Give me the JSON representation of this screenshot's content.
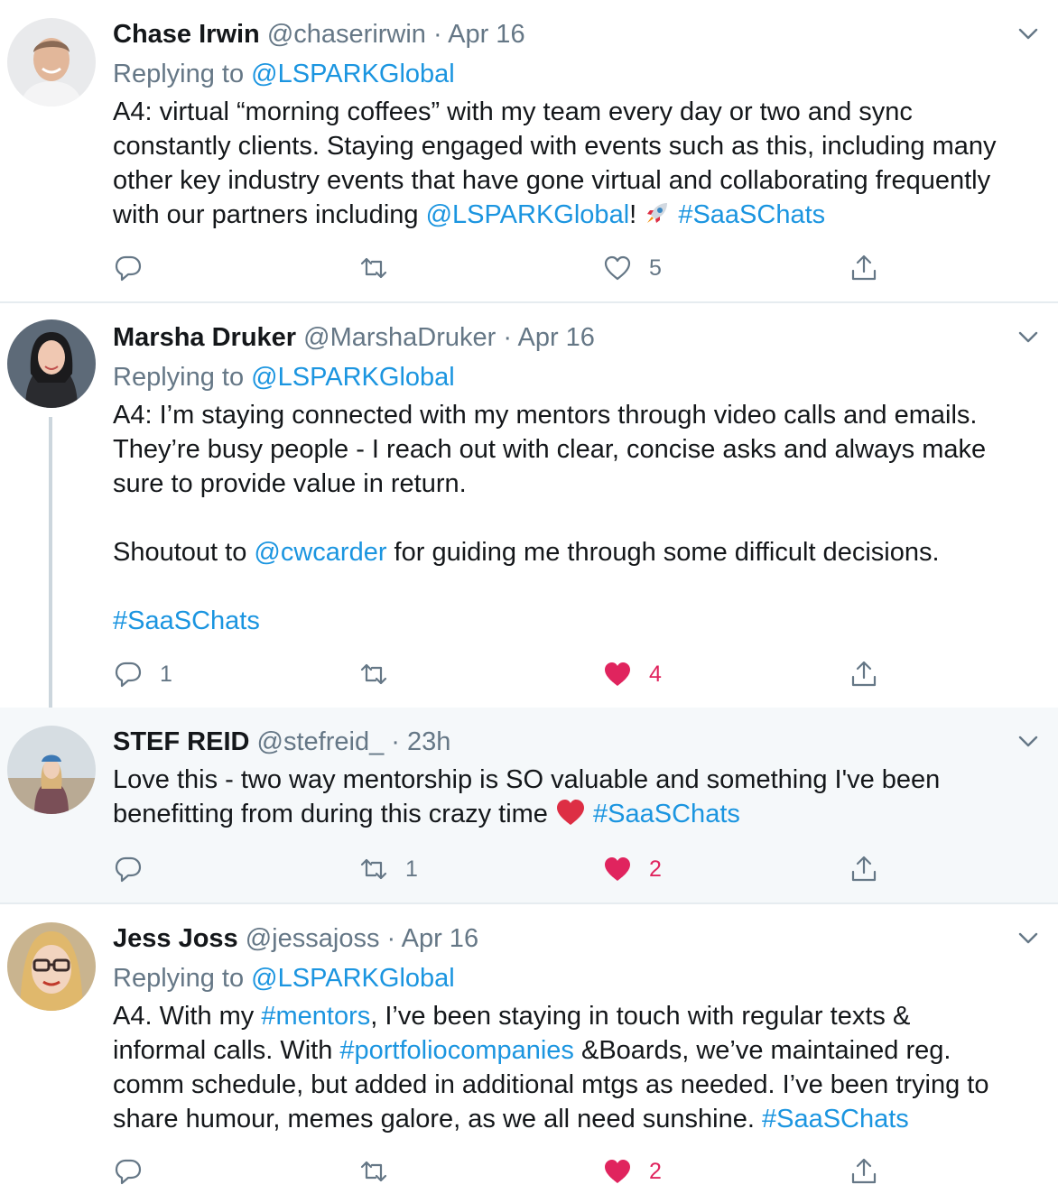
{
  "accent_color": "#1b95e0",
  "like_color": "#e0245e",
  "tweets": [
    {
      "name": "Chase Irwin",
      "handle": "@chaserirwin",
      "sep": " · ",
      "time": "Apr 16",
      "replying_prefix": "Replying to ",
      "replying_handle": "@LSPARKGlobal",
      "body": {
        "t1": "A4: virtual “morning coffees” with my team every day or two and sync constantly clients. Staying engaged with events such as this, including many other key industry events that have gone virtual and collaborating frequently with our partners including ",
        "mention": "@LSPARKGlobal",
        "t2": "! ",
        "emoji": "rocket",
        "t3": " ",
        "hashtag": "#SaaSChats"
      },
      "reply_count": "",
      "retweet_count": "",
      "like_count": "5",
      "liked": false
    },
    {
      "name": "Marsha Druker",
      "handle": "@MarshaDruker",
      "sep": " · ",
      "time": "Apr 16",
      "replying_prefix": "Replying to ",
      "replying_handle": "@LSPARKGlobal",
      "body": {
        "p1": "A4: I’m staying connected with my mentors through video calls and emails. They’re busy people - I reach out with clear, concise asks and always make sure to provide value in return.",
        "p2a": "Shoutout to ",
        "p2mention": "@cwcarder",
        "p2b": " for guiding me through some difficult decisions.",
        "p3hashtag": "#SaaSChats"
      },
      "reply_count": "1",
      "retweet_count": "",
      "like_count": "4",
      "liked": true
    },
    {
      "name": "STEF REID",
      "handle": "@stefreid_",
      "sep": " · ",
      "time": "23h",
      "body": {
        "t1": "Love this - two way mentorship is SO valuable and something I've been benefitting from during this crazy time ",
        "emoji": "red-heart",
        "t2": " ",
        "hashtag": "#SaaSChats"
      },
      "reply_count": "",
      "retweet_count": "1",
      "like_count": "2",
      "liked": true
    },
    {
      "name": "Jess Joss",
      "handle": "@jessajoss",
      "sep": " · ",
      "time": "Apr 16",
      "replying_prefix": "Replying to ",
      "replying_handle": "@LSPARKGlobal",
      "body": {
        "t1": "A4. With my ",
        "hashtag1": "#mentors",
        "t2": ", I’ve been staying in touch with regular texts & informal calls. With ",
        "hashtag2": "#portfoliocompanies",
        "t3": " &Boards, we’ve maintained reg. comm schedule, but added in additional mtgs as needed. I’ve been trying to share humour, memes galore, as we all need sunshine. ",
        "hashtag3": "#SaaSChats"
      },
      "reply_count": "",
      "retweet_count": "",
      "like_count": "2",
      "liked": true
    }
  ]
}
